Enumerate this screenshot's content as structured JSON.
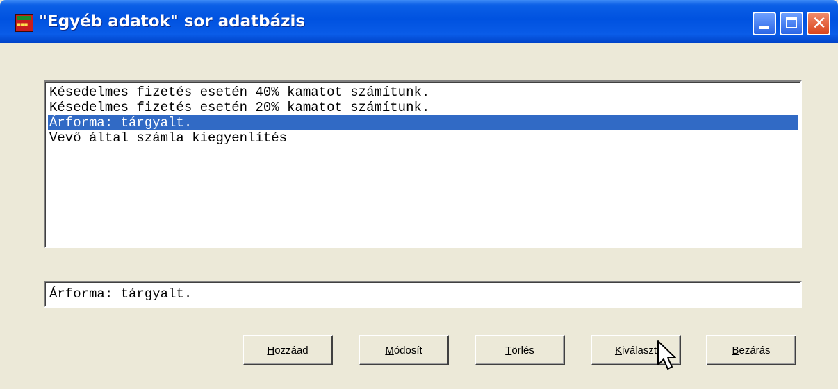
{
  "window": {
    "title": "\"Egyéb adatok\" sor adatbázis",
    "icon": "app-icon"
  },
  "caption_buttons": {
    "minimize": "minimize-icon",
    "maximize": "maximize-icon",
    "close": "close-icon"
  },
  "list": {
    "items": [
      "Késedelmes fizetés esetén 40% kamatot számítunk.",
      "Késedelmes fizetés esetén 20% kamatot számítunk.",
      "Árforma: tárgyalt.",
      "Vevő által számla kiegyenlítés"
    ],
    "selected_index": 2,
    "selection_color": "#316ac5"
  },
  "edit": {
    "value": "Árforma: tárgyalt."
  },
  "buttons": {
    "add": {
      "accel": "H",
      "rest": "ozzáad"
    },
    "modify": {
      "accel": "M",
      "rest": "ódosít"
    },
    "delete": {
      "accel": "T",
      "rest": "örlés"
    },
    "select": {
      "accel": "K",
      "rest": "iválaszt"
    },
    "close": {
      "accel": "B",
      "rest": "ezárás"
    }
  },
  "colors": {
    "titlebar": "#0052e0",
    "dialog_bg": "#ece9d8",
    "close_button": "#d9441c"
  }
}
